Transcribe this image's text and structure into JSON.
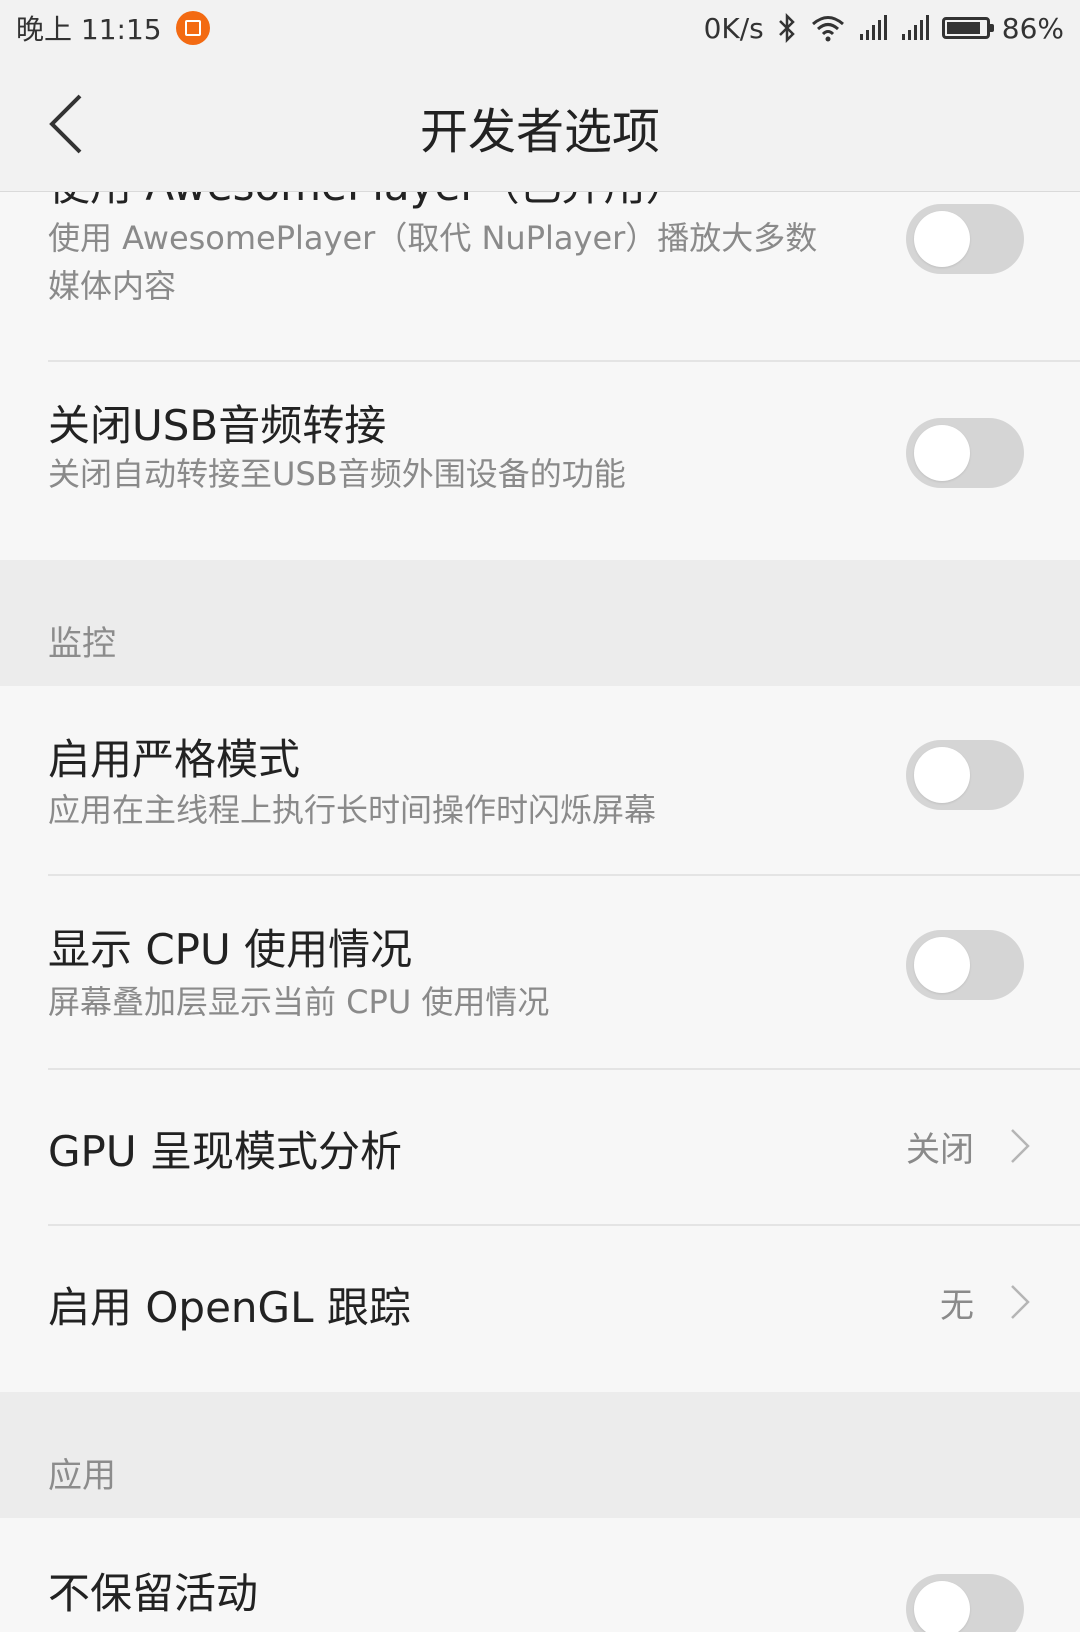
{
  "status_bar": {
    "time": "晚上 11:15",
    "net_speed": "0K/s",
    "battery_level": 0.86,
    "battery_text": "86%"
  },
  "app_bar": {
    "title": "开发者选项"
  },
  "items": {
    "awesomeplayer": {
      "title": "使用 AwesomePlayer（已弃用）",
      "subtitle": "使用 AwesomePlayer（取代 NuPlayer）播放大多数媒体内容",
      "checked": false
    },
    "usb_audio": {
      "title": "关闭USB音频转接",
      "subtitle": "关闭自动转接至USB音频外围设备的功能",
      "checked": false
    },
    "strict_mode": {
      "title": "启用严格模式",
      "subtitle": "应用在主线程上执行长时间操作时闪烁屏幕",
      "checked": false
    },
    "cpu_usage": {
      "title": "显示 CPU 使用情况",
      "subtitle": "屏幕叠加层显示当前 CPU 使用情况",
      "checked": false
    },
    "gpu_profile": {
      "title": "GPU 呈现模式分析",
      "value": "关闭"
    },
    "opengl_trace": {
      "title": "启用 OpenGL 跟踪",
      "value": "无"
    },
    "dont_keep": {
      "title": "不保留活动",
      "checked": false
    }
  },
  "sections": {
    "monitoring": "监控",
    "apps": "应用"
  },
  "icons": {
    "back": "chevron-left-icon",
    "chevron": "chevron-right-icon",
    "bluetooth": "bluetooth-icon",
    "wifi": "wifi-icon",
    "signal": "signal-icon",
    "battery": "battery-icon",
    "app_badge": "app-notification-icon"
  },
  "colors": {
    "accent_badge": "#f36a12",
    "toggle_off": "#d5d5d5"
  }
}
